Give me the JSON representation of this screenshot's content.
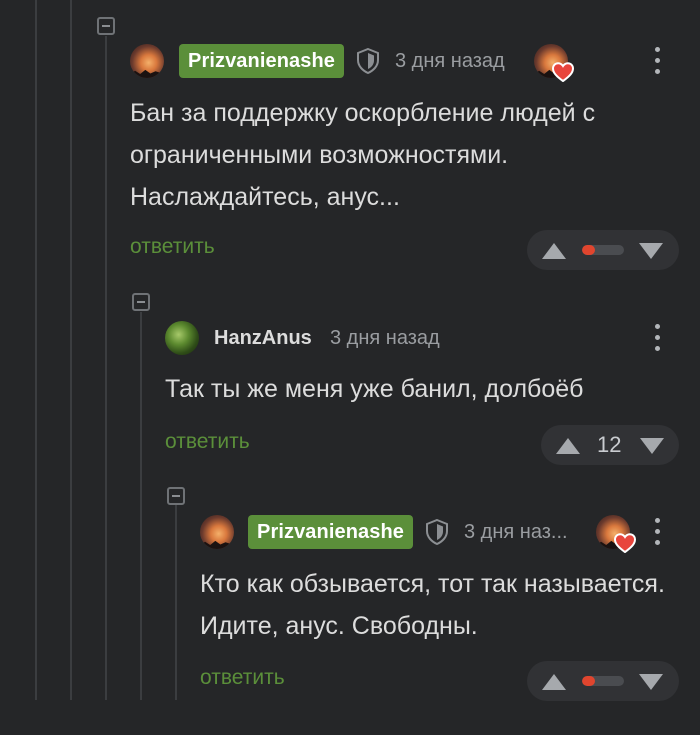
{
  "colors": {
    "background": "#252628",
    "name_badge_bg": "#5b8f3a",
    "reply_link": "#5b8f3a",
    "rating_negative": "#e0452e",
    "meta_text": "#9a9da1"
  },
  "comments": [
    {
      "author": "Prizvanienashe",
      "author_style": "badge",
      "has_shield_icon": true,
      "time": "3 дня назад",
      "has_heart_avatar": true,
      "text": "Бан за поддержку оскорбление людей с ограниченными возможностями. Наслаждайтесь, анус...",
      "reply_label": "ответить",
      "rating_display": "bar",
      "negative_share": 0.3
    },
    {
      "author": "HanzAnus",
      "author_style": "plain",
      "has_shield_icon": false,
      "time": "3 дня назад",
      "has_heart_avatar": false,
      "text": "Так ты же меня уже банил, долбоёб",
      "reply_label": "ответить",
      "rating_display": "number",
      "rating": "12"
    },
    {
      "author": "Prizvanienashe",
      "author_style": "badge",
      "has_shield_icon": true,
      "time": "3 дня наз...",
      "has_heart_avatar": true,
      "text": "Кто как обзывается, тот так называется. Идите, анус. Свободны.",
      "reply_label": "ответить",
      "rating_display": "bar",
      "negative_share": 0.3
    }
  ]
}
